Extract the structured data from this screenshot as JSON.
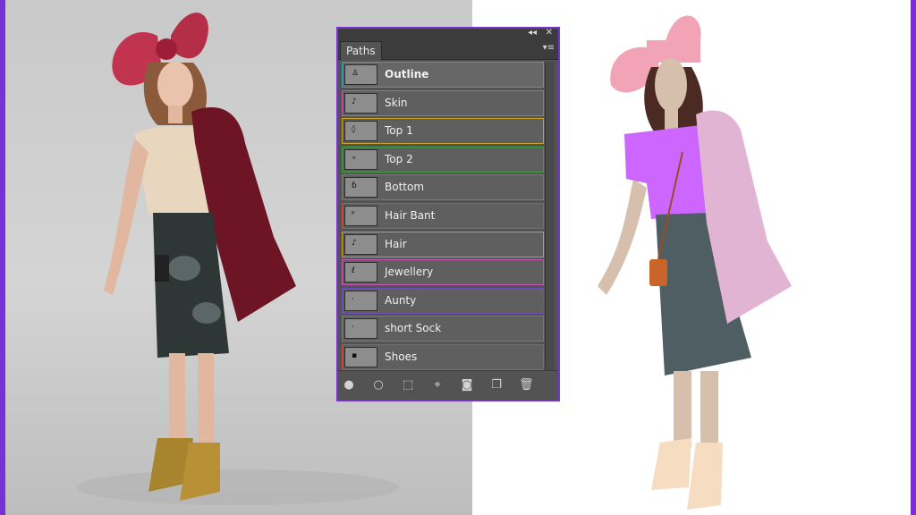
{
  "panel": {
    "tab_label": "Paths",
    "collapse_glyph": "◂◂",
    "close_glyph": "✕",
    "menu_glyph": "▾≡",
    "paths": [
      {
        "name": "Outline",
        "selected": true,
        "border": "#3aa6b9",
        "thumb": "♙"
      },
      {
        "name": "Skin",
        "border": "#c45ab3",
        "thumb": "♪"
      },
      {
        "name": "Top 1",
        "border": "#c9a227",
        "thumb": "◊"
      },
      {
        "name": "Top 2",
        "border": "#3da23d",
        "thumb": "∘"
      },
      {
        "name": "Bottom",
        "border": "#7a7a7a",
        "thumb": "ɓ"
      },
      {
        "name": "Hair Bant",
        "border": "#c8503a",
        "thumb": "ᵖ"
      },
      {
        "name": "Hair",
        "border": "#c9a227",
        "thumb": "♪"
      },
      {
        "name": "Jewellery",
        "border": "#c45ab3",
        "thumb": "ℓ"
      },
      {
        "name": "Aunty",
        "border": "#6d4fb8",
        "thumb": "·"
      },
      {
        "name": "short Sock",
        "border": "#7a7a7a",
        "thumb": "·"
      },
      {
        "name": "Shoes",
        "border": "#c8503a",
        "thumb": "▪"
      }
    ],
    "footer_icons": [
      {
        "name": "fill-path-icon",
        "glyph": "●"
      },
      {
        "name": "stroke-path-icon",
        "glyph": "○"
      },
      {
        "name": "load-as-selection-icon",
        "glyph": "⬚"
      },
      {
        "name": "make-work-path-icon",
        "glyph": "⌖"
      },
      {
        "name": "add-mask-icon",
        "glyph": "◙"
      },
      {
        "name": "new-path-icon",
        "glyph": "❐"
      },
      {
        "name": "delete-path-icon",
        "glyph": "🗑"
      }
    ]
  },
  "colors": {
    "frame": "#7b2fd6",
    "panel_bg": "#535353",
    "illus_bow": "#f2a3b5",
    "illus_top": "#cc66ff",
    "illus_jacket": "#e2b4d4",
    "illus_skirt": "#4e5e62",
    "illus_skin": "#d7bfae",
    "illus_shoes": "#f6dcc0"
  }
}
